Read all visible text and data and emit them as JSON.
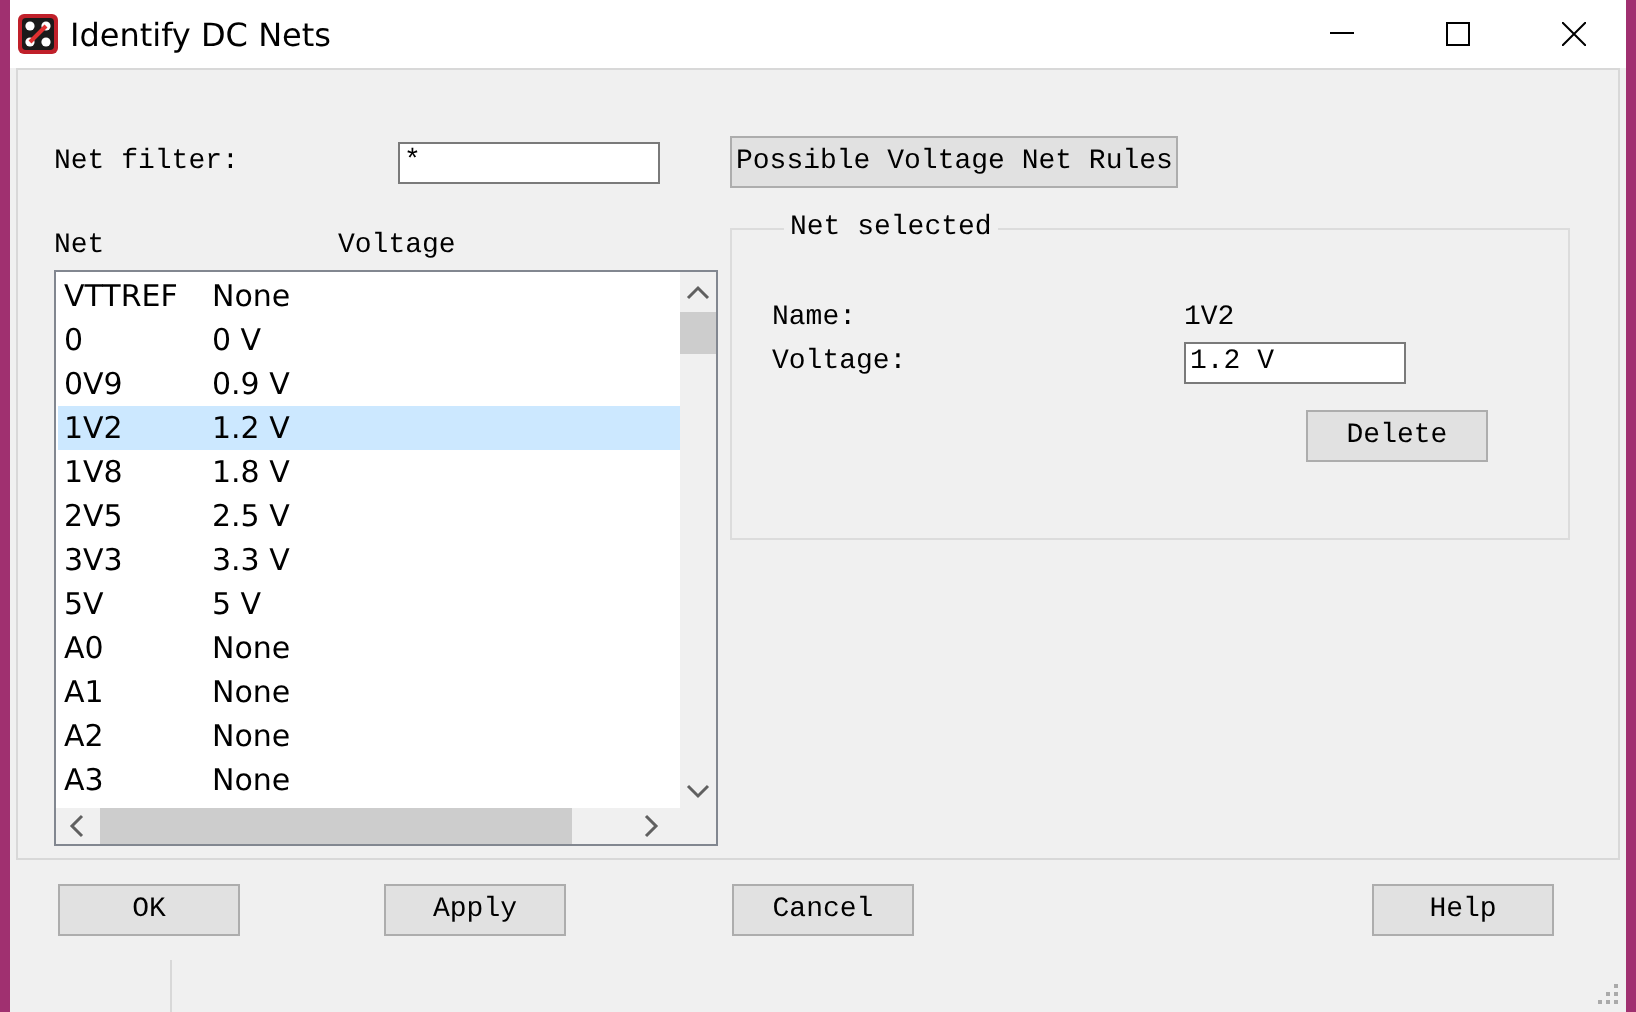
{
  "window": {
    "title": "Identify DC Nets"
  },
  "filter": {
    "label": "Net filter:",
    "value": "*"
  },
  "rules_button": "Possible Voltage Net Rules",
  "list": {
    "columns": [
      "Net",
      "Voltage"
    ],
    "rows": [
      {
        "net": "VTTREF",
        "voltage": "None",
        "selected": false
      },
      {
        "net": "0",
        "voltage": "0 V",
        "selected": false
      },
      {
        "net": "0V9",
        "voltage": "0.9 V",
        "selected": false
      },
      {
        "net": "1V2",
        "voltage": "1.2 V",
        "selected": true
      },
      {
        "net": "1V8",
        "voltage": "1.8 V",
        "selected": false
      },
      {
        "net": "2V5",
        "voltage": "2.5 V",
        "selected": false
      },
      {
        "net": "3V3",
        "voltage": "3.3 V",
        "selected": false
      },
      {
        "net": "5V",
        "voltage": "5 V",
        "selected": false
      },
      {
        "net": "A0",
        "voltage": "None",
        "selected": false
      },
      {
        "net": "A1",
        "voltage": "None",
        "selected": false
      },
      {
        "net": "A2",
        "voltage": "None",
        "selected": false
      },
      {
        "net": "A3",
        "voltage": "None",
        "selected": false
      }
    ]
  },
  "net_selected": {
    "title": "Net selected",
    "name_label": "Name:",
    "name_value": "1V2",
    "voltage_label": "Voltage:",
    "voltage_value": "1.2 V",
    "delete_button": "Delete"
  },
  "buttons": [
    "OK",
    "Apply",
    "Cancel",
    "Help"
  ]
}
